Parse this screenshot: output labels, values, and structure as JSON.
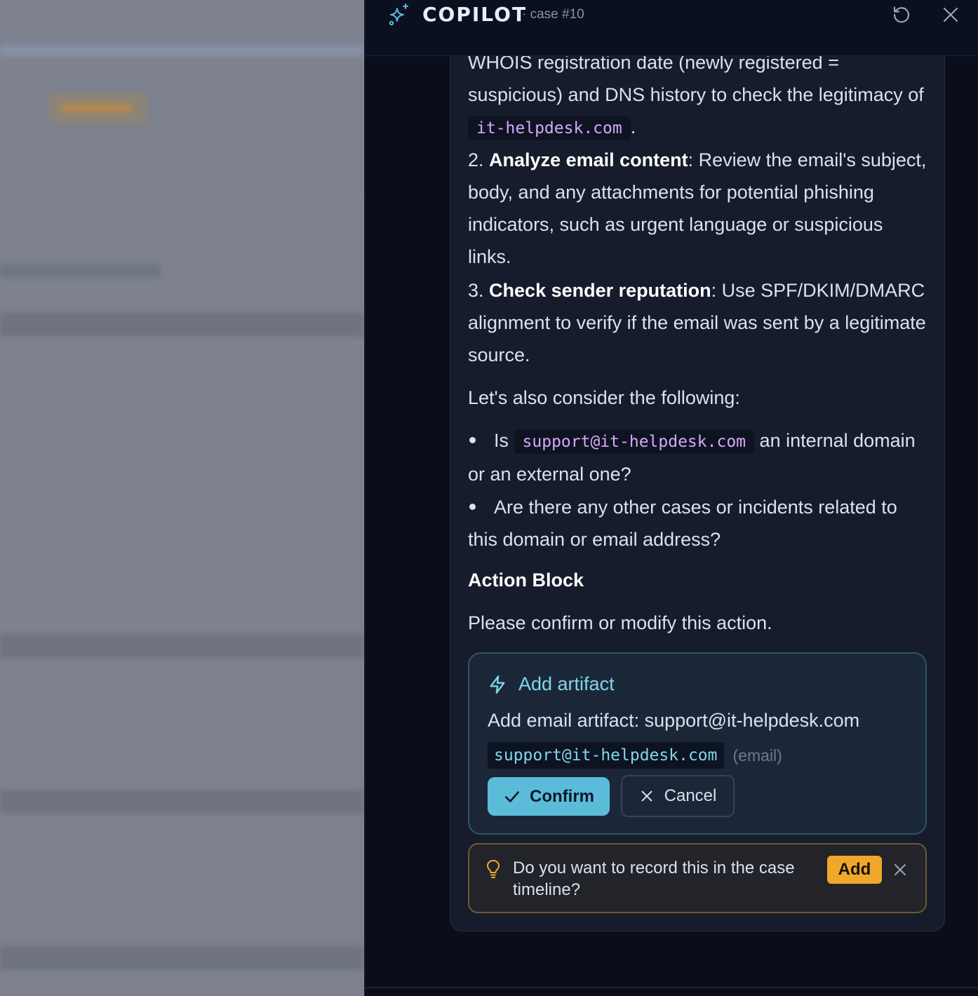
{
  "header": {
    "title": "COPILOT",
    "case_label": "· case #10",
    "icons": {
      "brand": "sparkle-icon",
      "reset": "refresh-icon",
      "close": "close-icon"
    }
  },
  "message": {
    "p1_text": "WHOIS registration date (newly registered = suspicious) and DNS history to check the legitimacy of",
    "p1_code": "it-helpdesk.com",
    "p1_end": ".",
    "step2_num": "2.",
    "step2_bold": "Analyze email content",
    "step2_text": ": Review the email's subject, body, and any attachments for potential phishing indicators, such as urgent language or suspicious links.",
    "step3_num": "3.",
    "step3_bold": "Check sender reputation",
    "step3_text": ": Use SPF/DKIM/DMARC alignment to verify if the email was sent by a legitimate source.",
    "consider": "Let's also consider the following:",
    "bullet1_pre": "Is",
    "bullet1_code": "support@it-helpdesk.com",
    "bullet1_post": "an internal domain or an external one?",
    "bullet2": "Are there any other cases or incidents related to this domain or email address?",
    "action_block_title": "Action Block",
    "action_block_sub": "Please confirm or modify this action."
  },
  "action_card": {
    "title": "Add artifact",
    "description": "Add email artifact: support@it-helpdesk.com",
    "value": "support@it-helpdesk.com",
    "type": "(email)",
    "confirm_label": "Confirm",
    "cancel_label": "Cancel",
    "icons": {
      "title": "lightning-icon",
      "confirm": "check-icon",
      "cancel": "x-icon"
    }
  },
  "suggestion": {
    "text": "Do you want to record this in the case timeline?",
    "add_label": "Add",
    "icons": {
      "bulb": "lightbulb-icon",
      "dismiss": "close-icon"
    }
  },
  "colors": {
    "accent": "#5bbcd9",
    "accent_text": "#7fd7ec",
    "code_pink": "#d6a8f7",
    "warning": "#f0a72a",
    "panel_bg": "#0a0e1b",
    "bubble_bg": "#161c2c"
  }
}
